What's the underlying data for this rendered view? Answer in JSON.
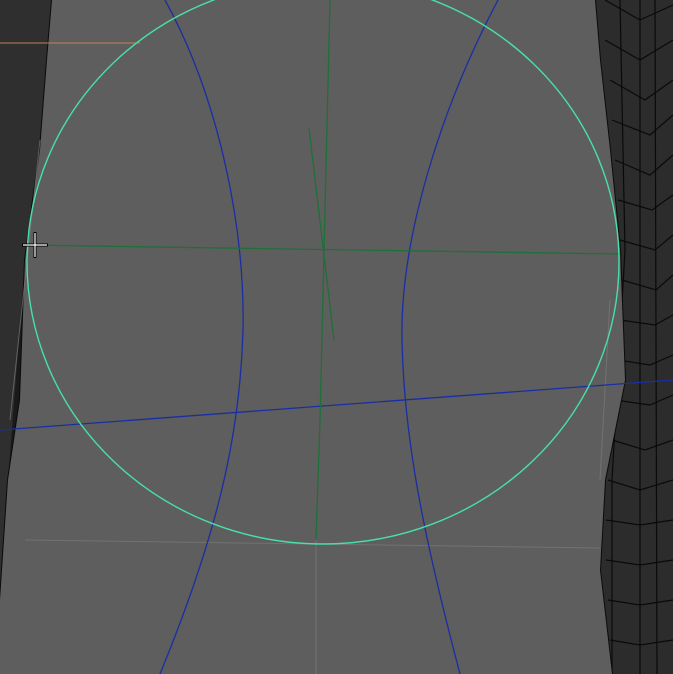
{
  "viewport": {
    "view": "3d-modeling-viewport",
    "mode": "wireframe-on-shaded",
    "active_tool": "move-rotate-manipulator",
    "cursor": "crosshair-cursor",
    "colors": {
      "background": "#1a1a1a",
      "mesh_face_left": "#2f2f2f",
      "mesh_face_right": "#2c2c2c",
      "mesh_face_main": "#5e5e5e",
      "mesh_edge": "#0b0b0b",
      "mesh_edge_light": "#8a8a8a",
      "grid_line_orange": "#c77e5b",
      "manipulator_ring": "#47e0a6",
      "manipulator_axis_blue": "#1a2ea3",
      "manipulator_axis_green": "#1f6f3a",
      "cursor_color": "#ffffff"
    }
  }
}
